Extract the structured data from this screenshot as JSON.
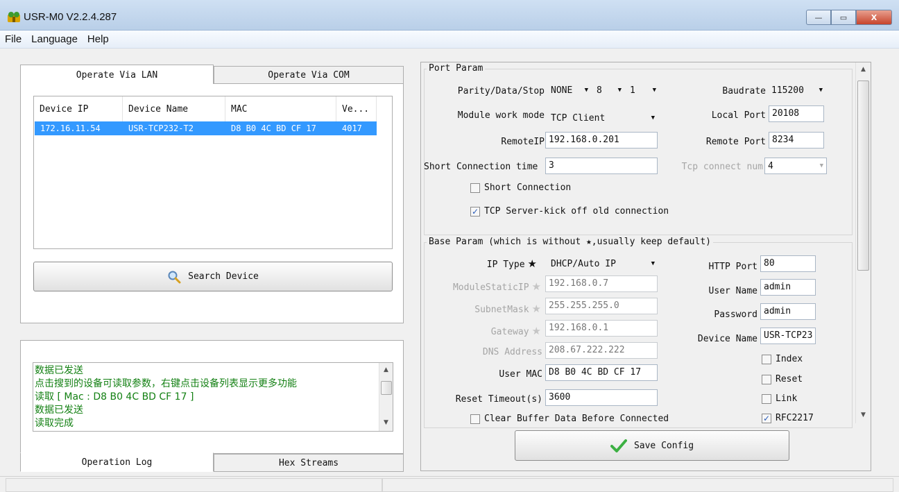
{
  "window": {
    "title": "USR-M0 V2.2.4.287",
    "min_label": "—",
    "max_label": "▭",
    "close_label": "X"
  },
  "menu": {
    "items": [
      "File",
      "Language",
      "Help"
    ]
  },
  "left": {
    "tabs": [
      "Operate Via LAN",
      "Operate Via COM"
    ],
    "table": {
      "columns": [
        "Device IP",
        "Device Name",
        "MAC",
        "Ve..."
      ],
      "rows": [
        [
          "172.16.11.54",
          "USR-TCP232-T2",
          "D8 B0 4C BD CF 17",
          "4017"
        ]
      ]
    },
    "search_button": "Search Device",
    "log_lines": [
      "数据已发送",
      "点击搜到的设备可读取参数，右键点击设备列表显示更多功能",
      "读取 [ Mac : D8 B0 4C BD CF 17 ]",
      "数据已发送",
      "读取完成"
    ],
    "bottom_tabs": [
      "Operation Log",
      "Hex Streams"
    ]
  },
  "port_param": {
    "title": "Port Param",
    "parity_label": "Parity/Data/Stop",
    "parity": "NONE",
    "data_bits": "8",
    "stop_bits": "1",
    "baudrate_label": "Baudrate",
    "baudrate": "115200",
    "work_mode_label": "Module work mode",
    "work_mode": "TCP Client",
    "local_port_label": "Local Port",
    "local_port": "20108",
    "remote_ip_label": "RemoteIP",
    "remote_ip": "192.168.0.201",
    "remote_port_label": "Remote Port",
    "remote_port": "8234",
    "short_conn_time_label": "Short Connection time",
    "short_conn_time": "3",
    "tcp_connect_num_label": "Tcp connect num",
    "tcp_connect_num": "4",
    "short_connection_label": "Short Connection",
    "short_connection_checked": false,
    "kick_off_label": "TCP Server-kick off old connection",
    "kick_off_checked": true
  },
  "base_param": {
    "title": "Base Param (which is without ★,usually keep default)",
    "ip_type_label": "IP Type",
    "ip_type": "DHCP/Auto IP",
    "static_ip_label": "ModuleStaticIP",
    "static_ip": "192.168.0.7",
    "subnet_label": "SubnetMask",
    "subnet": "255.255.255.0",
    "gateway_label": "Gateway",
    "gateway": "192.168.0.1",
    "dns_label": "DNS Address",
    "dns": "208.67.222.222",
    "user_mac_label": "User MAC",
    "user_mac": "D8 B0 4C BD CF 17",
    "reset_timeout_label": "Reset Timeout(s)",
    "reset_timeout": "3600",
    "clear_buffer_label": "Clear Buffer Data Before Connected",
    "clear_buffer_checked": false,
    "http_port_label": "HTTP Port",
    "http_port": "80",
    "user_name_label": "User Name",
    "user_name": "admin",
    "password_label": "Password",
    "password": "admin",
    "device_name_label": "Device Name",
    "device_name": "USR-TCP23",
    "index_label": "Index",
    "index_checked": false,
    "reset_label": "Reset",
    "reset_checked": false,
    "link_label": "Link",
    "link_checked": false,
    "rfc_label": "RFC2217",
    "rfc_checked": true
  },
  "save_button": "Save Config",
  "colors": {
    "selection": "#3399ff",
    "log_text": "#138013",
    "check_mark": "#2a5cb8"
  }
}
